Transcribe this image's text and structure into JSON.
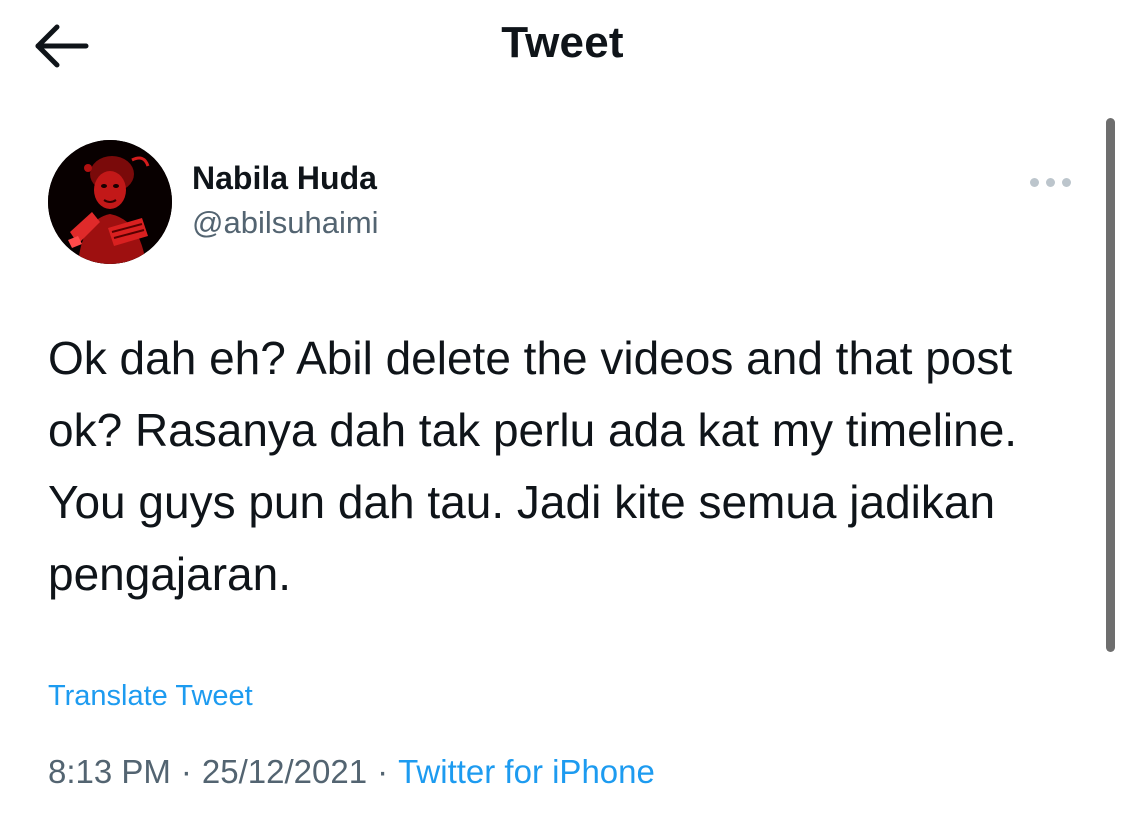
{
  "header": {
    "back_icon": "arrow-left-icon",
    "title": "Tweet"
  },
  "tweet": {
    "author": {
      "display_name": "Nabila Huda",
      "handle": "@abilsuhaimi",
      "avatar_icon": "avatar-photo"
    },
    "more_icon": "ellipsis-icon",
    "text": "Ok dah eh? Abil delete the videos and that post ok? Rasanya dah tak perlu ada kat my timeline. You guys pun dah tau. Jadi kite semua jadikan pengajaran.",
    "translate_label": "Translate Tweet",
    "time": "8:13 PM",
    "separator": "·",
    "date": "25/12/2021",
    "source": "Twitter for iPhone"
  },
  "colors": {
    "text_primary": "#0f1419",
    "text_secondary": "#536471",
    "link": "#1d9bf0",
    "background": "#ffffff"
  }
}
